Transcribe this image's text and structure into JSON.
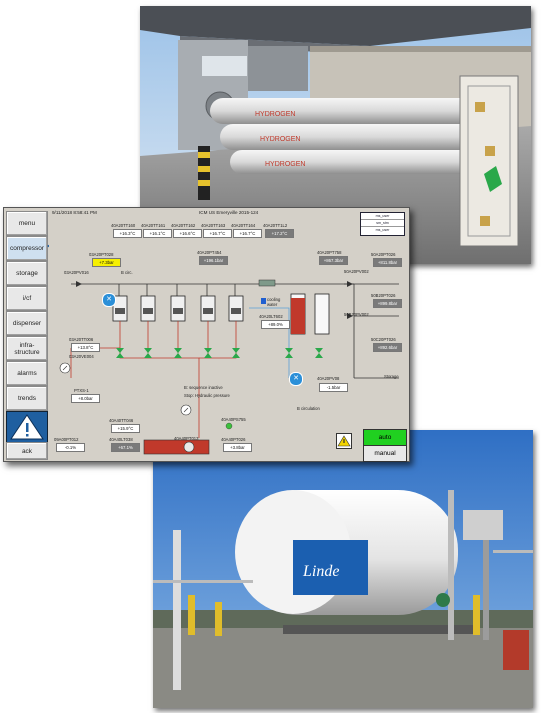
{
  "hmi": {
    "header": {
      "datetime": "9/11/2018 8:58:41 PM",
      "station": "ICM US Emeryville 2015-124",
      "users": [
        "ms_user",
        "sm_stm",
        "ms_user"
      ]
    },
    "nav": [
      "menu",
      "compressor",
      "storage",
      "i/cf",
      "dispenser",
      "infra-\nstructure",
      "alarms",
      "trends",
      "ack"
    ],
    "nav_active": "compressor",
    "alarm_icon": "warning-triangle-icon",
    "modes": {
      "auto": "auto",
      "manual": "manual"
    },
    "colors": {
      "panel": "#d4d0c8",
      "auto": "#20d020",
      "pipe_hot": "#c0392b",
      "pipe_sweep": "#5aa0d8",
      "tank": "#c0392b"
    },
    "labels": {
      "pt_top_left": "03A20PT028",
      "valve_top_left": "03A20PV016",
      "bypass": "0A20PV003",
      "b_circ": "B circ.",
      "pt1": "40A20TT160",
      "pt2": "40A20TT161",
      "pt3": "40A20TT162",
      "pt4": "40A20TT163",
      "pt5": "40A20TT164",
      "pt6": "40A20TT1L2",
      "pt_mid": "40A20PT454",
      "pt_right": "40A20PT758",
      "cooling": "cooling\nwater",
      "lt": "40A20LT602",
      "tt006": "03A20TT006",
      "ve004": "03A20VE004",
      "ptxs": "PTXS-1",
      "pv_right": "50A20PV002",
      "pv_right2": "50B20PV002",
      "pt_r1": "50A20PT026",
      "pt_r2": "50B20PT026",
      "pt_r3": "50C20PT026",
      "storage": "Storage",
      "sequence": "B: sequence inactive",
      "hydraulic": "Stop: Hydraulic pressure",
      "tt046": "40A40TT046",
      "lt038": "40A40LT038",
      "pt013": "40A40PT013",
      "ps755": "40A40PS755",
      "pt026": "40A40PT026",
      "pt012": "09A00PT012",
      "pt_mid2": "40A40PV003",
      "b_circ2": "B circulation",
      "pf2": "40A20PV08",
      "valve_a": "40A20PV001",
      "valve_b": "40A20PV002",
      "valve_c": "40A20PV003",
      "valve_d": "40A20PV004",
      "valve_e": "40A20PV005",
      "valve_f": "40A20PV006",
      "valve_g": "40A20PV007"
    },
    "values": {
      "v_yellow": "+7.3bar",
      "t1": "+16.3°C",
      "t2": "+16.1°C",
      "t3": "+16.6°C",
      "t4": "+16.7°C",
      "t5": "+16.7°C",
      "t6": "+17.2°C",
      "p_mid": "+196.1bar",
      "p_right": "+867.3bar",
      "lt_val": "+89.0%",
      "tt006_val": "+13.8°C",
      "ptxs_val": "+8.0bar",
      "r1": "+811.8bar",
      "r2": "+899.8bar",
      "r3": "+892.6bar",
      "pf_val": "-1.5bar",
      "tt046_val": "+15.9°C",
      "lt038_val": "+67.1%",
      "pt026_val": "+3.8bar",
      "pt012_val": "-0.1%"
    }
  }
}
